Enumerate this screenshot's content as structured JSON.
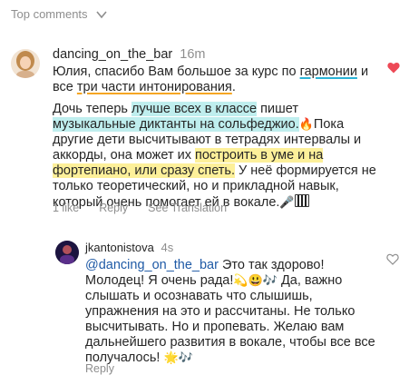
{
  "header": {
    "sort_label": "Top comments"
  },
  "comment1": {
    "username": "dancing_on_the_bar",
    "time": "16m",
    "lines": [
      [
        "Юлия, спасибо Вам большое за курс по ",
        "гармонии",
        " и"
      ],
      [
        "все ",
        "три части интонирования",
        "."
      ],
      [
        " Дочь теперь ",
        "лучше всех в классе",
        " пишет"
      ],
      [
        "музыкальные диктанты на сольфеджио.",
        "🔥",
        "Пока"
      ],
      [
        "другие дети высчитывают в тетрадях интервалы и"
      ],
      [
        "аккорды, она может их ",
        "построить в уме и на"
      ],
      [
        "фортепиано, или сразу спеть.",
        " У неё формируется не"
      ],
      [
        "только теоретический, но и прикладной навык,"
      ],
      [
        "который очень помогает ей в вокале.",
        "🎤"
      ]
    ],
    "actions": {
      "likes": "1 like",
      "reply": "Reply",
      "translation": "See Translation"
    },
    "liked": true,
    "heart_color": "#ed4956"
  },
  "reply1": {
    "username": "jkantonistova",
    "time": "4s",
    "mention": "@dancing_on_the_bar",
    "lines": [
      [
        " Это так здорово!"
      ],
      [
        "Молодец! Я очень рада!",
        "💫😃🎶",
        " Да, важно"
      ],
      [
        "слышать и осознавать что слышишь,"
      ],
      [
        "упражнения на это и рассчитаны. Не только"
      ],
      [
        "высчитывать. Но и пропевать. Желаю вам"
      ],
      [
        "дальнейшего развития в вокале, чтобы все все"
      ],
      [
        "получалось! ",
        "🌟🎶"
      ]
    ],
    "actions": {
      "reply": "Reply"
    }
  }
}
